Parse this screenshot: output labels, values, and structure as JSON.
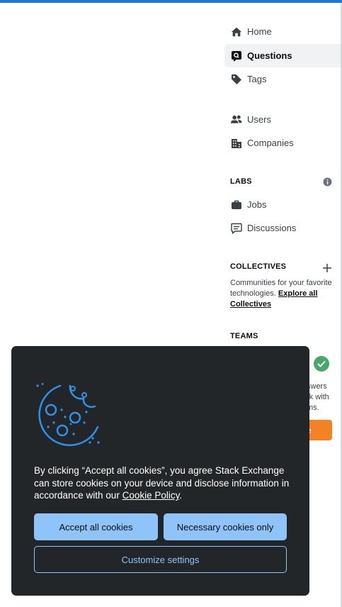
{
  "nav": {
    "home": "Home",
    "questions": "Questions",
    "tags": "Tags",
    "users": "Users",
    "companies": "Companies"
  },
  "labs": {
    "title": "LABS",
    "jobs": "Jobs",
    "discussions": "Discussions"
  },
  "collectives": {
    "title": "COLLECTIVES",
    "desc_line1": "Communities for your favorite",
    "desc_line2": "technologies.",
    "explore_link_line1": "Explore all",
    "explore_link_line2": "Collectives"
  },
  "teams": {
    "title": "TEAMS",
    "partial_line1": "swers",
    "partial_line2": "rk with",
    "partial_line3": "ms.",
    "button_partial": "e"
  },
  "cookie": {
    "text_before": "By clicking “Accept all cookies”, you agree Stack Exchange can store cookies on your device and disclose information in accordance with our ",
    "link": "Cookie Policy",
    "text_after": ".",
    "accept_all": "Accept all cookies",
    "necessary_only": "Necessary cookies only",
    "customize": "Customize settings"
  },
  "colors": {
    "accent": "#1f78d1",
    "dialog_bg": "#232629",
    "button_blue": "#8ec4f8",
    "teams_orange": "#f48225",
    "check_green": "#48a868"
  }
}
